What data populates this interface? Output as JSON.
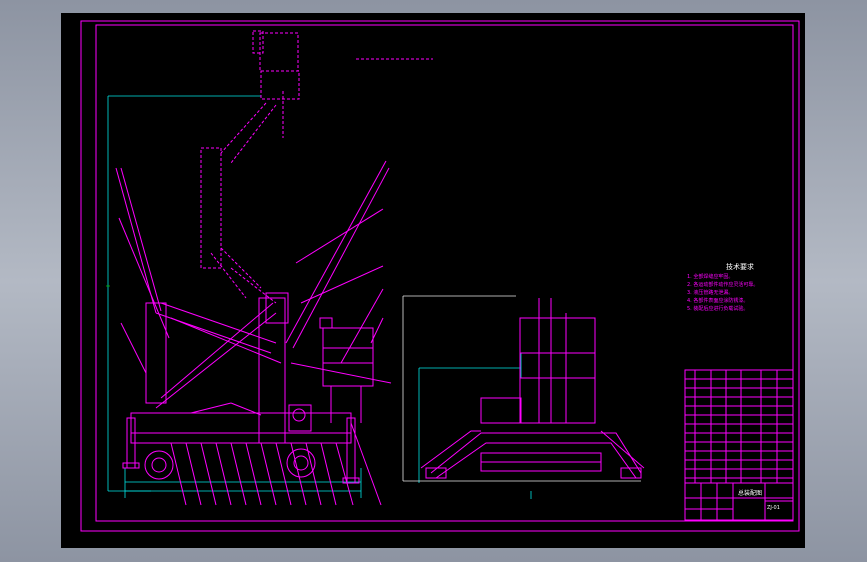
{
  "drawing": {
    "tech_requirements_title": "技术要求",
    "tech_requirements": [
      "1. 全部焊缝应牢固。",
      "2. 各运动部件动作应灵活可靠。",
      "3. 液压管路无泄漏。",
      "4. 各部件表面应涂防锈漆。",
      "5. 装配后应进行负载试验。"
    ],
    "title_block": {
      "drawing_title": "总装配图",
      "drawing_number": "ZJ-01"
    },
    "colors": {
      "background": "#000000",
      "frame": "#ff00ff",
      "dimension": "#00e5e5",
      "annotation": "#ffffff"
    }
  }
}
